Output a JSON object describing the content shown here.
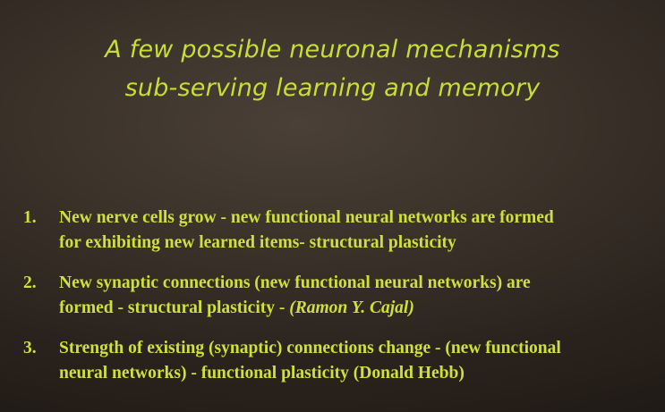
{
  "title": {
    "line1": "A few possible neuronal mechanisms",
    "line2": "sub-serving learning and memory"
  },
  "items": [
    {
      "number": "1.",
      "line1": "New nerve cells grow - new functional neural networks are formed",
      "line2": "for exhibiting new learned items- structural plasticity"
    },
    {
      "number": "2.",
      "line1": "New synaptic connections (new functional neural networks) are",
      "line2_pre": "formed - structural plasticity - ",
      "line2_italic": "(Ramon Y. Cajal)"
    },
    {
      "number": "3.",
      "line1": "Strength of existing (synaptic) connections change - (new functional",
      "line2": "neural networks) - functional plasticity (Donald Hebb)"
    }
  ],
  "colors": {
    "text": "#cfe03d",
    "background": "#3a3129"
  }
}
